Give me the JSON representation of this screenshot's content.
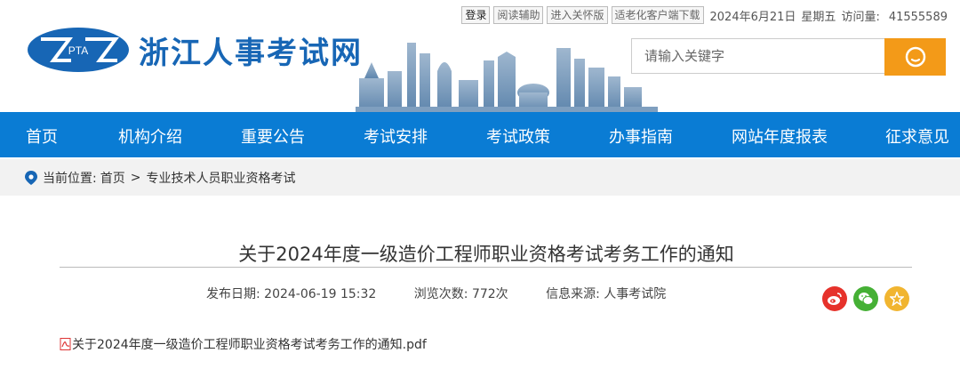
{
  "top_bar": {
    "login": "登录",
    "reading_aid": "阅读辅助",
    "care_version": "进入关怀版",
    "elder_client": "适老化客户端下载",
    "date": "2024年6月21日",
    "weekday": "星期五",
    "visits_label": "访问量:",
    "visits_value": "41555589"
  },
  "logo": {
    "badge_text": "PTA",
    "site_name": "浙江人事考试网"
  },
  "search": {
    "placeholder": "请输入关键字"
  },
  "nav": {
    "items": [
      "首页",
      "机构介绍",
      "重要公告",
      "考试安排",
      "考试政策",
      "办事指南",
      "网站年度报表",
      "征求意见"
    ]
  },
  "breadcrumb": {
    "label": "当前位置:",
    "home": "首页",
    "separator": ">",
    "current": "专业技术人员职业资格考试"
  },
  "article": {
    "title": "关于2024年度一级造价工程师职业资格考试考务工作的通知",
    "publish_date": "发布日期:  2024-06-19 15:32",
    "views": "浏览次数:  772次",
    "source": "信息来源:  人事考试院",
    "attachment": "关于2024年度一级造价工程师职业资格考试考务工作的通知.pdf"
  },
  "colors": {
    "nav_bg": "#0a7cd4",
    "brand_blue": "#1766b5",
    "search_btn": "#f39a18",
    "weibo": "#e6322b",
    "wechat": "#45b035",
    "favorite": "#f1b530"
  },
  "icons": [
    "location-pin-icon",
    "search-icon",
    "weibo-icon",
    "wechat-icon",
    "star-icon",
    "pdf-icon"
  ]
}
